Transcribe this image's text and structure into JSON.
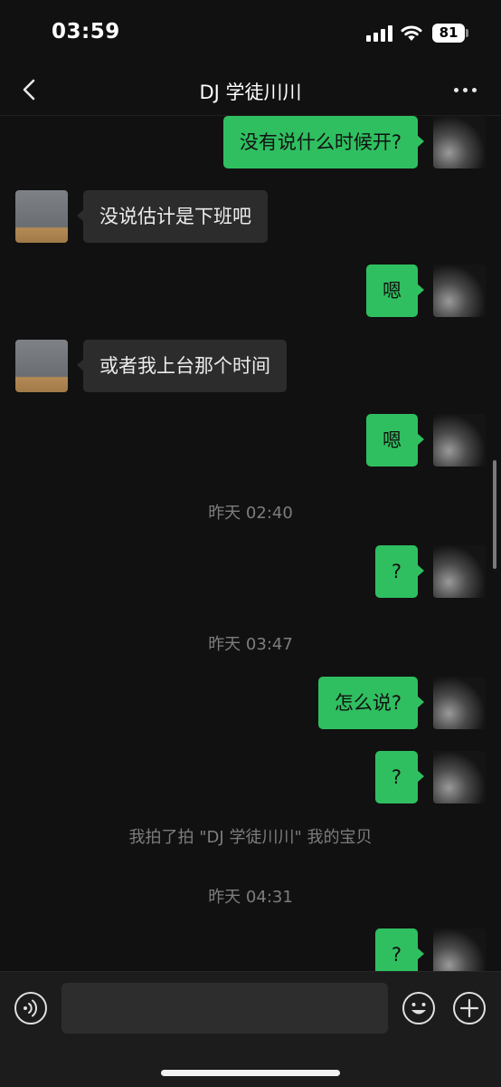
{
  "status_bar": {
    "time": "03:59",
    "battery": "81",
    "icons": [
      "signal-icon",
      "wifi-icon",
      "battery-icon"
    ]
  },
  "header": {
    "title": "DJ 学徒川川",
    "back_icon": "chevron-left-icon",
    "more_icon": "ellipsis-icon"
  },
  "messages": [
    {
      "side": "out",
      "text": "没有说什么时候开?"
    },
    {
      "side": "in",
      "text": "没说估计是下班吧"
    },
    {
      "side": "out",
      "text": "嗯"
    },
    {
      "side": "in",
      "text": "或者我上台那个时间"
    },
    {
      "side": "out",
      "text": "嗯"
    },
    {
      "timestamp": "昨天 02:40"
    },
    {
      "side": "out",
      "text": "?"
    },
    {
      "timestamp": "昨天 03:47"
    },
    {
      "side": "out",
      "text": "怎么说?"
    },
    {
      "side": "out",
      "text": "?"
    },
    {
      "system": "我拍了拍 \"DJ 学徒川川\" 我的宝贝"
    },
    {
      "timestamp": "昨天 04:31"
    },
    {
      "side": "out",
      "text": "?"
    }
  ],
  "input_bar": {
    "value": "",
    "placeholder": "",
    "icons": [
      "voice-icon",
      "emoji-icon",
      "plus-icon"
    ]
  },
  "colors": {
    "background": "#111111",
    "outgoing_bubble": "#2fbf60",
    "incoming_bubble": "#2c2c2c",
    "timestamp_text": "#7d7d7d"
  }
}
